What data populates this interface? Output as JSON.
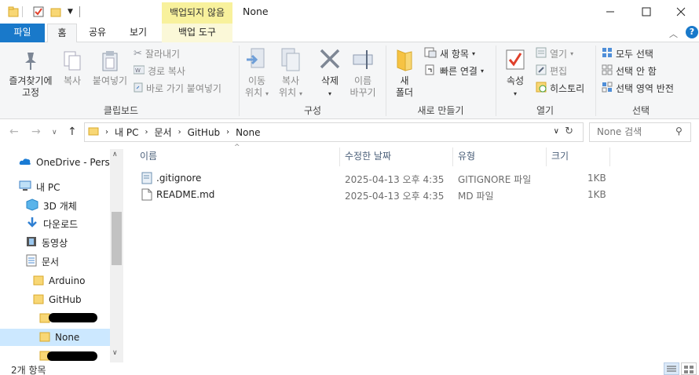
{
  "window": {
    "context_tab_group": "백업되지 않음",
    "title": "None"
  },
  "ribbon_tabs": [
    {
      "label": "파일"
    },
    {
      "label": "홈"
    },
    {
      "label": "공유"
    },
    {
      "label": "보기"
    },
    {
      "label": "백업 도구"
    }
  ],
  "clipboard": {
    "pin_quick_access": [
      "즐겨찾기에",
      "고정"
    ],
    "copy": "복사",
    "paste": "붙여넣기",
    "cut": "잘라내기",
    "copy_path": "경로 복사",
    "paste_shortcut": "바로 가기 붙여넣기",
    "group_label": "클립보드"
  },
  "organize": {
    "move_to": [
      "이동",
      "위치"
    ],
    "copy_to": [
      "복사",
      "위치"
    ],
    "delete": "삭제",
    "rename": [
      "이름",
      "바꾸기"
    ],
    "group_label": "구성"
  },
  "new": {
    "new_folder": [
      "새",
      "폴더"
    ],
    "new_item": "새 항목",
    "easy_access": "빠른 연결",
    "group_label": "새로 만들기"
  },
  "open": {
    "properties": "속성",
    "open": "열기",
    "edit": "편집",
    "history": "히스토리",
    "group_label": "열기"
  },
  "select": {
    "select_all": "모두 선택",
    "select_none": "선택 안 함",
    "invert": "선택 영역 반전",
    "group_label": "선택"
  },
  "address": {
    "crumbs": [
      "내 PC",
      "문서",
      "GitHub",
      "None"
    ],
    "search_placeholder": "None 검색"
  },
  "nav_pane": {
    "items": [
      {
        "label": "OneDrive - Person"
      },
      {
        "label": "내 PC"
      },
      {
        "label": "3D 개체"
      },
      {
        "label": "다운로드"
      },
      {
        "label": "동영상"
      },
      {
        "label": "문서"
      },
      {
        "label": "Arduino"
      },
      {
        "label": "GitHub"
      },
      {
        "label": ""
      },
      {
        "label": "None"
      },
      {
        "label": ""
      }
    ]
  },
  "file_list": {
    "columns": [
      "이름",
      "수정한 날짜",
      "유형",
      "크기"
    ],
    "rows": [
      {
        "name": ".gitignore",
        "modified": "2025-04-13 오후 4:35",
        "type": "GITIGNORE 파일",
        "size": "1KB"
      },
      {
        "name": "README.md",
        "modified": "2025-04-13 오후 4:35",
        "type": "MD 파일",
        "size": "1KB"
      }
    ]
  },
  "status": {
    "item_count": "2개 항목"
  },
  "colors": {
    "file_tab": "#1979ca",
    "context_tab": "#f8f19c",
    "selection": "#cce8ff"
  }
}
